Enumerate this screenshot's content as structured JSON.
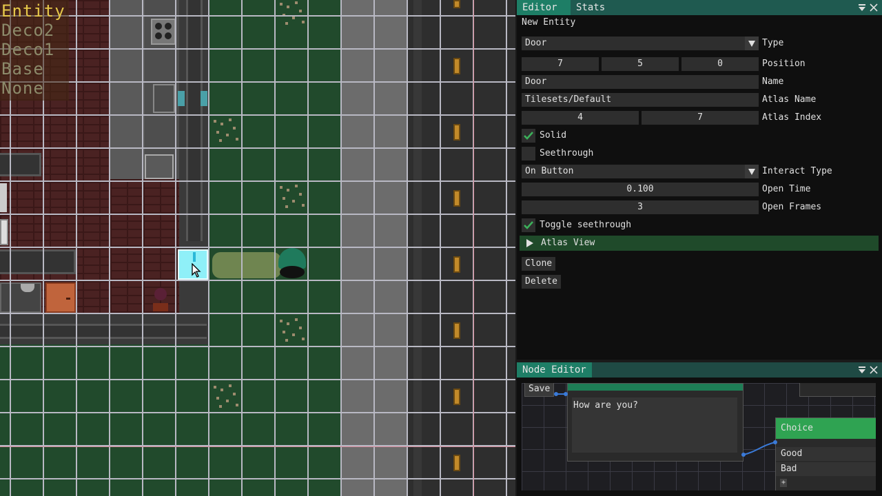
{
  "layers": {
    "items": [
      {
        "label": "Entity",
        "color": "#e6c84a"
      },
      {
        "label": "Deco2",
        "color": "#8c8a6a"
      },
      {
        "label": "Deco1",
        "color": "#8c8a6a"
      },
      {
        "label": "Base",
        "color": "#8c8a6a"
      },
      {
        "label": "None",
        "color": "#8c8a6a"
      }
    ]
  },
  "editor": {
    "tabs": [
      {
        "label": "Editor"
      },
      {
        "label": "Stats"
      }
    ],
    "header": "New Entity",
    "type": {
      "value": "Door",
      "label": "Type"
    },
    "position": {
      "x": "7",
      "y": "5",
      "z": "0",
      "label": "Position"
    },
    "name": {
      "value": "Door",
      "label": "Name"
    },
    "atlas_name": {
      "value": "Tilesets/Default",
      "label": "Atlas Name"
    },
    "atlas_index": {
      "a": "4",
      "b": "7",
      "label": "Atlas Index"
    },
    "solid": {
      "label": "Solid",
      "checked": true
    },
    "seethrough": {
      "label": "Seethrough",
      "checked": false
    },
    "interact_type": {
      "value": "On Button",
      "label": "Interact Type"
    },
    "open_time": {
      "value": "0.100",
      "label": "Open Time"
    },
    "open_frames": {
      "value": "3",
      "label": "Open Frames"
    },
    "toggle_seethrough": {
      "label": "Toggle seethrough",
      "checked": true
    },
    "atlas_view": {
      "label": "Atlas View"
    },
    "clone_label": "Clone",
    "delete_label": "Delete"
  },
  "node_editor": {
    "title": "Node Editor",
    "save_label": "Save",
    "dialog_text": "How are you?",
    "choice_title": "Choice",
    "choices": [
      "Good",
      "Bad"
    ],
    "add_label": "+"
  },
  "colors": {
    "accent_tab": "#1e7e66",
    "title_bar": "#1f5a50",
    "check": "#3cb05a",
    "choice_header": "#2fa352",
    "atlas_header": "#1f4a2a"
  }
}
